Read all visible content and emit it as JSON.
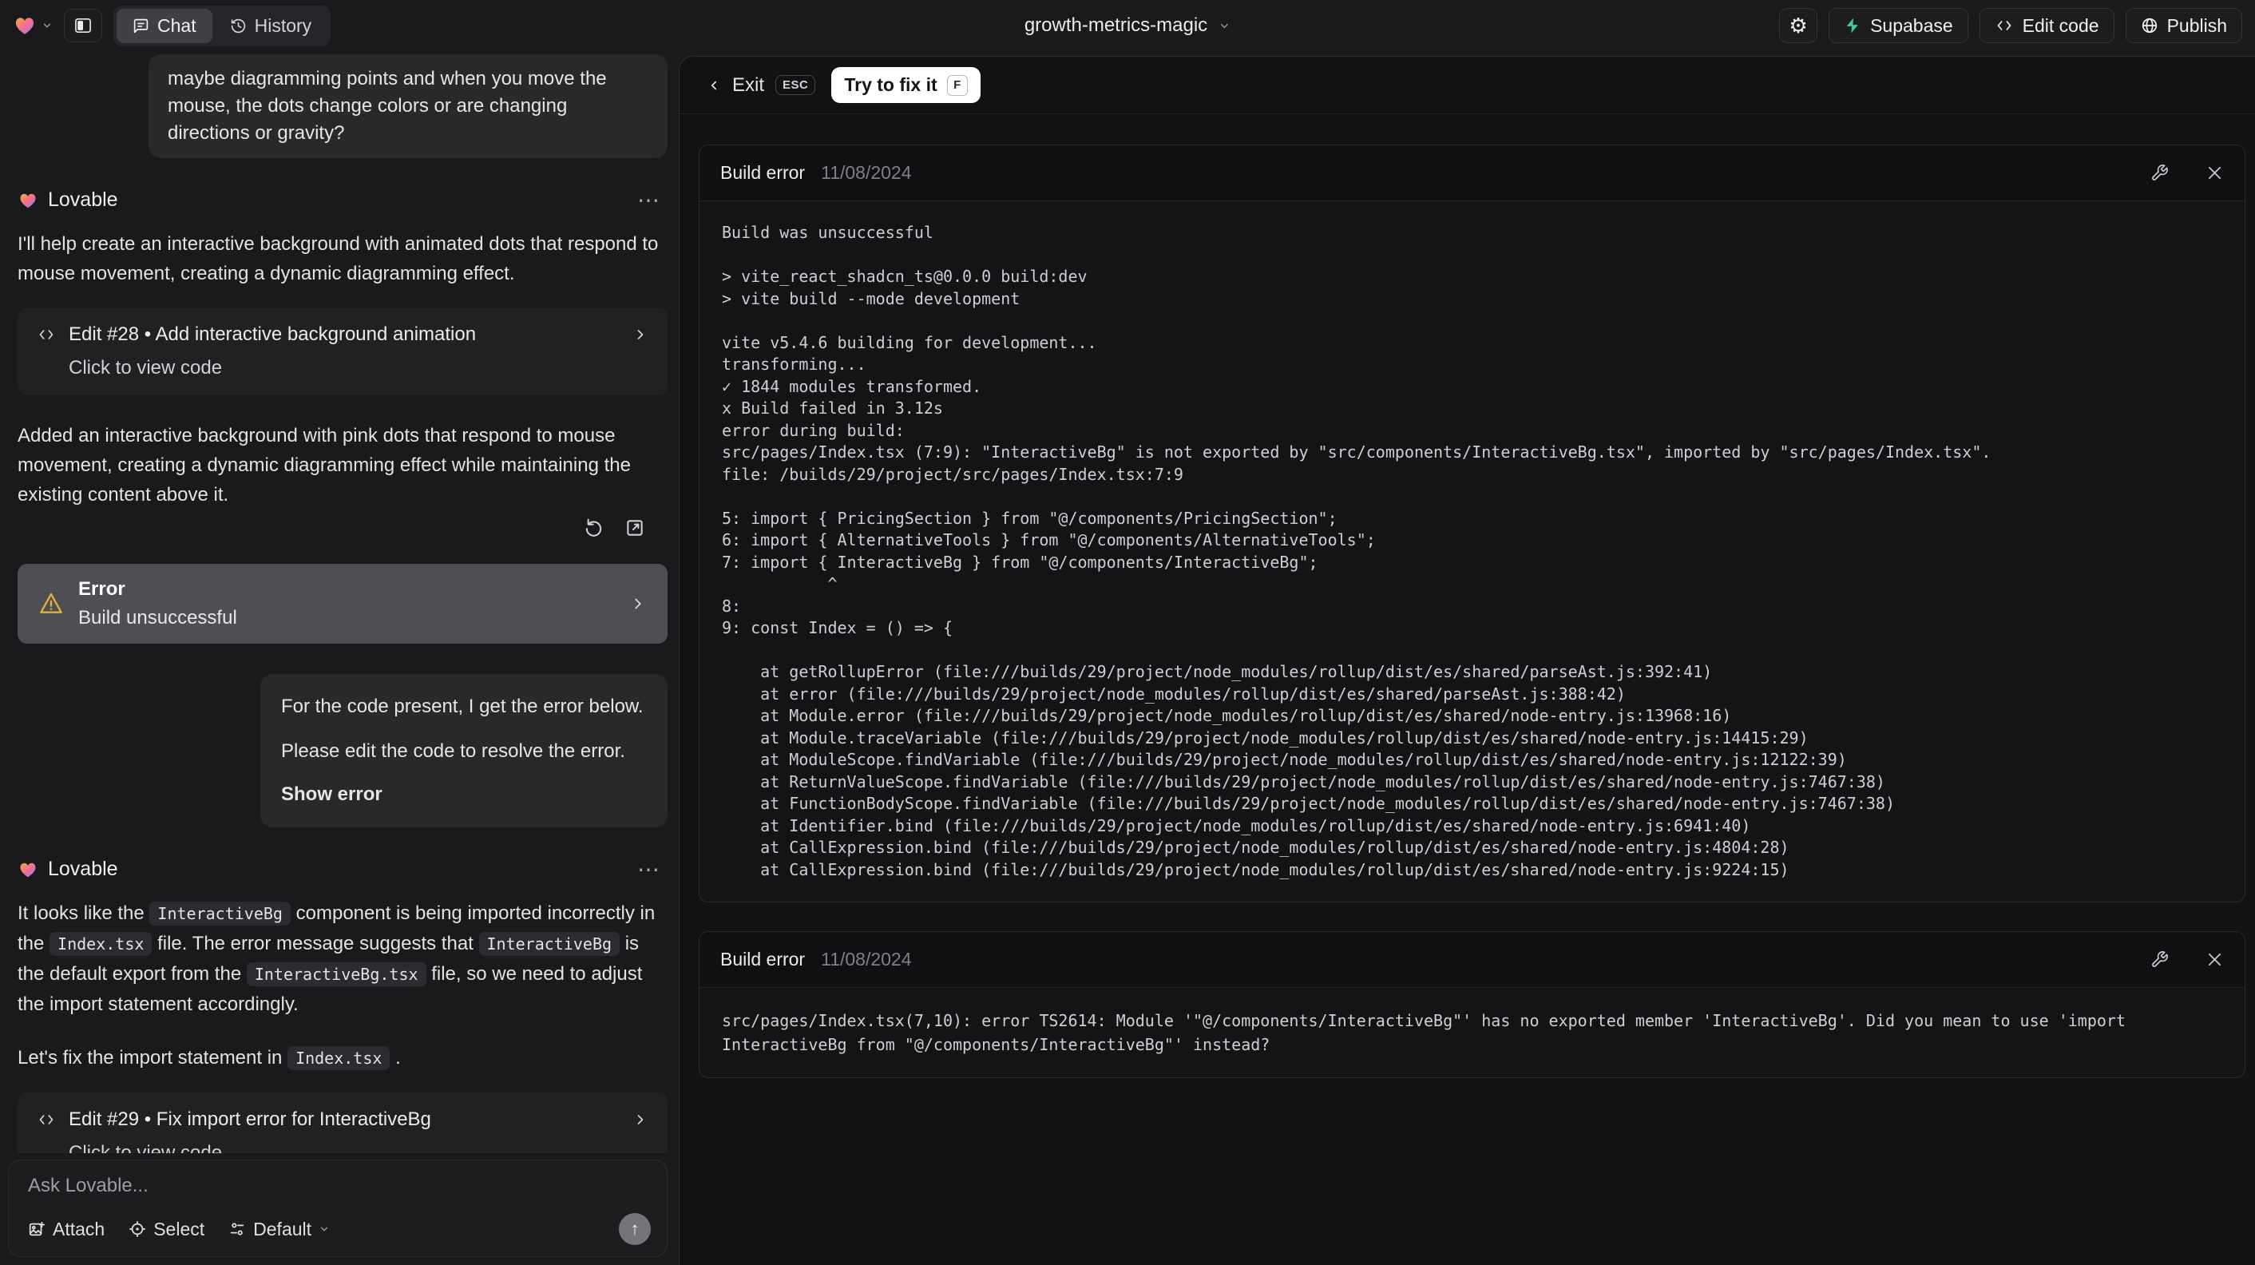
{
  "colors": {
    "supabase_green": "#3ecf8e",
    "warning_amber": "#e0b03f",
    "try_fix_button_bg": "#ffffff",
    "error_card_bg": "#4e4e54"
  },
  "icons": {
    "gear": "⚙",
    "more": "⋯",
    "send": "↑"
  },
  "topbar": {
    "project_name": "growth-metrics-magic",
    "tabs": {
      "chat": "Chat",
      "history": "History"
    },
    "buttons": {
      "supabase": "Supabase",
      "edit_code": "Edit code",
      "publish": "Publish"
    }
  },
  "fixbar": {
    "exit": "Exit",
    "esc": "ESC",
    "try_fix": "Try to fix it",
    "key": "F"
  },
  "chat": {
    "assistant_name": "Lovable",
    "user_message_1": "maybe diagramming points and when you move the mouse, the dots change colors or are changing directions or gravity?",
    "msg1_intro": "I'll help create an interactive background with animated dots that respond to mouse movement, creating a dynamic diagramming effect.",
    "edit28": {
      "title": "Edit #28 • Add interactive background animation",
      "subtitle": "Click to view code"
    },
    "msg1_result": "Added an interactive background with pink dots that respond to mouse movement, creating a dynamic diagramming effect while maintaining the existing content above it.",
    "error_card": {
      "title": "Error",
      "subtitle": "Build unsuccessful"
    },
    "user_message_2": {
      "line1": "For the code present, I get the error below.",
      "line2": "Please edit the code to resolve the error.",
      "action": "Show error"
    },
    "msg2_rich": [
      {
        "text": "It looks like the "
      },
      {
        "code": true,
        "text": "InteractiveBg"
      },
      {
        "text": " component is being imported incorrectly in the "
      },
      {
        "code": true,
        "text": "Index.tsx"
      },
      {
        "text": " file. The error message suggests that "
      },
      {
        "code": true,
        "text": "InteractiveBg"
      },
      {
        "text": " is the default export from the "
      },
      {
        "code": true,
        "text": "InteractiveBg.tsx"
      },
      {
        "text": " file, so we need to adjust the import statement accordingly."
      }
    ],
    "msg2b_rich": [
      {
        "text": "Let's fix the import statement in "
      },
      {
        "code": true,
        "text": "Index.tsx"
      },
      {
        "text": " ."
      }
    ],
    "edit29": {
      "title": "Edit #29 • Fix import error for InteractiveBg",
      "subtitle": "Click to view code"
    }
  },
  "composer": {
    "placeholder": "Ask Lovable...",
    "attach": "Attach",
    "select": "Select",
    "mode": "Default"
  },
  "build_errors": [
    {
      "title": "Build error",
      "date": "11/08/2024",
      "log": [
        "Build was unsuccessful",
        "",
        "> vite_react_shadcn_ts@0.0.0 build:dev",
        "> vite build --mode development",
        "",
        "vite v5.4.6 building for development...",
        "transforming...",
        "✓ 1844 modules transformed.",
        "x Build failed in 3.12s",
        "error during build:",
        "src/pages/Index.tsx (7:9): \"InteractiveBg\" is not exported by \"src/components/InteractiveBg.tsx\", imported by \"src/pages/Index.tsx\".",
        "file: /builds/29/project/src/pages/Index.tsx:7:9",
        "",
        "5: import { PricingSection } from \"@/components/PricingSection\";",
        "6: import { AlternativeTools } from \"@/components/AlternativeTools\";",
        "7: import { InteractiveBg } from \"@/components/InteractiveBg\";",
        "           ^",
        "8: ",
        "9: const Index = () => {",
        "",
        "    at getRollupError (file:///builds/29/project/node_modules/rollup/dist/es/shared/parseAst.js:392:41)",
        "    at error (file:///builds/29/project/node_modules/rollup/dist/es/shared/parseAst.js:388:42)",
        "    at Module.error (file:///builds/29/project/node_modules/rollup/dist/es/shared/node-entry.js:13968:16)",
        "    at Module.traceVariable (file:///builds/29/project/node_modules/rollup/dist/es/shared/node-entry.js:14415:29)",
        "    at ModuleScope.findVariable (file:///builds/29/project/node_modules/rollup/dist/es/shared/node-entry.js:12122:39)",
        "    at ReturnValueScope.findVariable (file:///builds/29/project/node_modules/rollup/dist/es/shared/node-entry.js:7467:38)",
        "    at FunctionBodyScope.findVariable (file:///builds/29/project/node_modules/rollup/dist/es/shared/node-entry.js:7467:38)",
        "    at Identifier.bind (file:///builds/29/project/node_modules/rollup/dist/es/shared/node-entry.js:6941:40)",
        "    at CallExpression.bind (file:///builds/29/project/node_modules/rollup/dist/es/shared/node-entry.js:4804:28)",
        "    at CallExpression.bind (file:///builds/29/project/node_modules/rollup/dist/es/shared/node-entry.js:9224:15)"
      ]
    },
    {
      "title": "Build error",
      "date": "11/08/2024",
      "log": [
        "src/pages/Index.tsx(7,10): error TS2614: Module '\"@/components/InteractiveBg\"' has no exported member 'InteractiveBg'. Did you mean to use 'import InteractiveBg from \"@/components/InteractiveBg\"' instead?"
      ]
    }
  ]
}
